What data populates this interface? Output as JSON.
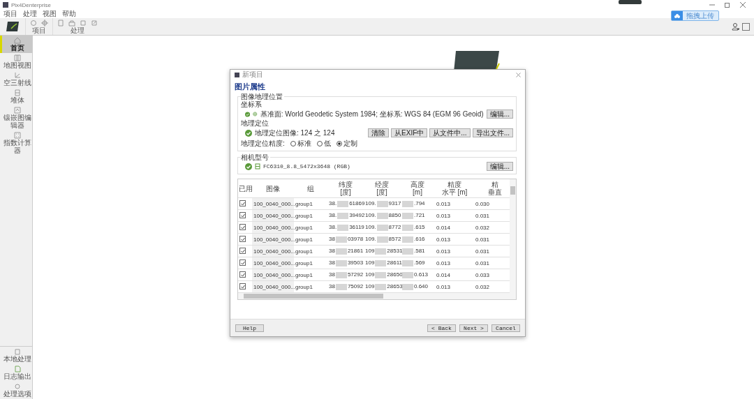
{
  "window": {
    "title": "Pix4Denterprise"
  },
  "menu": [
    "项目",
    "处理",
    "视图",
    "帮助"
  ],
  "toolbar": {
    "groups": [
      "项目",
      "处理"
    ],
    "upload_button": "拖拽上传"
  },
  "sidebar": {
    "items": [
      {
        "label": "首页",
        "selected": true
      },
      {
        "label": "地图视图",
        "selected": false
      },
      {
        "label": "空三射线",
        "selected": false
      },
      {
        "label": "堆体",
        "selected": false
      },
      {
        "label": "镶嵌图编辑器",
        "selected": false
      },
      {
        "label": "指数计算器",
        "selected": false
      }
    ],
    "bottom_items": [
      "本地处理",
      "日志输出",
      "处理选项"
    ]
  },
  "dialog": {
    "title": "新项目",
    "heading": "图片属性",
    "geolocation": {
      "legend": "图像地理位置",
      "coord_label": "坐标系",
      "coord_text": "基准面: World Geodetic System 1984; 坐标系: WGS 84 (EGM 96 Geoid)",
      "edit_button": "编辑...",
      "geo_label": "地理定位",
      "geo_text": "地理定位图像: 124 之 124",
      "buttons": [
        "清除",
        "从EXIF中",
        "从文件中...",
        "导出文件..."
      ],
      "accuracy_label": "地理定位精度:",
      "accuracy_options": [
        {
          "label": "标准",
          "selected": false
        },
        {
          "label": "低",
          "selected": false
        },
        {
          "label": "定制",
          "selected": true
        }
      ]
    },
    "camera": {
      "legend": "相机型号",
      "text": "FC6310_8.8_5472x3648 (RGB)",
      "edit_button": "编辑..."
    },
    "table": {
      "columns": [
        [
          "已用"
        ],
        [
          "图像"
        ],
        [
          "组"
        ],
        [
          "纬度",
          "[度]"
        ],
        [
          "经度",
          "[度]"
        ],
        [
          "高度",
          "[m]"
        ],
        [
          "精度",
          "水平 [m]"
        ],
        [
          "精",
          "垂直"
        ]
      ],
      "rows": [
        {
          "used": true,
          "image": "100_0040_000...",
          "group": "group1",
          "latitude": [
            "38.",
            "61869"
          ],
          "longitude": [
            "109.",
            "9317"
          ],
          "altitude": ".794",
          "h_accuracy": "0.013",
          "v_accuracy": "0.030"
        },
        {
          "used": true,
          "image": "100_0040_000...",
          "group": "group1",
          "latitude": [
            "38.",
            "39492"
          ],
          "longitude": [
            "109.",
            "8850"
          ],
          "altitude": ".721",
          "h_accuracy": "0.013",
          "v_accuracy": "0.031"
        },
        {
          "used": true,
          "image": "100_0040_000...",
          "group": "group1",
          "latitude": [
            "38.",
            "36119"
          ],
          "longitude": [
            "109.",
            "8772"
          ],
          "altitude": ".615",
          "h_accuracy": "0.014",
          "v_accuracy": "0.032"
        },
        {
          "used": true,
          "image": "100_0040_000...",
          "group": "group1",
          "latitude": [
            "38",
            "03978"
          ],
          "longitude": [
            "109.",
            "8572"
          ],
          "altitude": ".616",
          "h_accuracy": "0.013",
          "v_accuracy": "0.031"
        },
        {
          "used": true,
          "image": "100_0040_000...",
          "group": "group1",
          "latitude": [
            "38",
            "21861"
          ],
          "longitude": [
            "109",
            "28531"
          ],
          "altitude": ".581",
          "h_accuracy": "0.013",
          "v_accuracy": "0.031"
        },
        {
          "used": true,
          "image": "100_0040_000...",
          "group": "group1",
          "latitude": [
            "38",
            "39503"
          ],
          "longitude": [
            "109",
            "28611"
          ],
          "altitude": ".569",
          "h_accuracy": "0.013",
          "v_accuracy": "0.031"
        },
        {
          "used": true,
          "image": "100_0040_000...",
          "group": "group1",
          "latitude": [
            "38",
            "57292"
          ],
          "longitude": [
            "109",
            "28650"
          ],
          "altitude": "0.613",
          "h_accuracy": "0.014",
          "v_accuracy": "0.033"
        },
        {
          "used": true,
          "image": "100_0040_000...",
          "group": "group1",
          "latitude": [
            "38",
            "75092"
          ],
          "longitude": [
            "109",
            "28653"
          ],
          "altitude": "0.640",
          "h_accuracy": "0.013",
          "v_accuracy": "0.032"
        }
      ]
    },
    "buttons": {
      "help": "Help",
      "back": "< Back",
      "next": "Next >",
      "cancel": "Cancel"
    }
  }
}
